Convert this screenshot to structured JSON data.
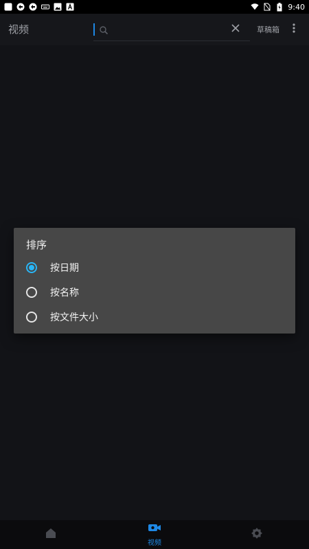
{
  "status_bar": {
    "time": "9:40",
    "icons": [
      "app-icon",
      "sync-icon",
      "sync-icon",
      "keyboard-icon",
      "image-icon",
      "text-icon",
      "wifi-icon",
      "no-sim-icon",
      "battery-icon"
    ]
  },
  "app_bar": {
    "title": "视频",
    "search": {
      "value": "",
      "placeholder": ""
    },
    "drafts_label": "草稿箱"
  },
  "sort_dialog": {
    "title": "排序",
    "options": [
      {
        "label": "按日期",
        "selected": true
      },
      {
        "label": "按名称",
        "selected": false
      },
      {
        "label": "按文件大小",
        "selected": false
      }
    ]
  },
  "bottom_nav": {
    "items": [
      {
        "icon": "home-icon",
        "label": "",
        "active": false
      },
      {
        "icon": "video-icon",
        "label": "视频",
        "active": true
      },
      {
        "icon": "settings-icon",
        "label": "",
        "active": false
      }
    ]
  },
  "colors": {
    "accent": "#29b6f6",
    "nav_active": "#1e88e5",
    "background": "#121317",
    "dialog": "#474747"
  }
}
